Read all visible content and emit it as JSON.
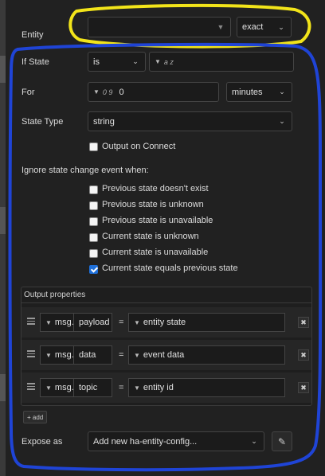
{
  "entity": {
    "label": "Entity",
    "value": "",
    "match": "exact"
  },
  "if_state": {
    "label": "If State",
    "operator": "is",
    "type_icon": "a z",
    "value": ""
  },
  "for": {
    "label": "For",
    "type_icon": "0 9",
    "value": "0",
    "unit": "minutes"
  },
  "state_type": {
    "label": "State Type",
    "value": "string"
  },
  "output_on_connect": {
    "label": "Output on Connect",
    "checked": false
  },
  "ignore": {
    "heading": "Ignore state change event when:",
    "options": [
      {
        "label": "Previous state doesn't exist",
        "checked": false
      },
      {
        "label": "Previous state is unknown",
        "checked": false
      },
      {
        "label": "Previous state is unavailable",
        "checked": false
      },
      {
        "label": "Current state is unknown",
        "checked": false
      },
      {
        "label": "Current state is unavailable",
        "checked": false
      },
      {
        "label": "Current state equals previous state",
        "checked": true
      }
    ]
  },
  "output_properties": {
    "heading": "Output properties",
    "rows": [
      {
        "prefix": "msg.",
        "property": "payload",
        "equals": "=",
        "value": "entity state"
      },
      {
        "prefix": "msg.",
        "property": "data",
        "equals": "=",
        "value": "event data"
      },
      {
        "prefix": "msg.",
        "property": "topic",
        "equals": "=",
        "value": "entity id"
      }
    ],
    "add_label": "+ add"
  },
  "expose_as": {
    "label": "Expose as",
    "value": "Add new ha-entity-config..."
  },
  "icons": {
    "chevron": "chevron-down-icon",
    "handle": "drag-handle-icon",
    "delete": "delete-icon",
    "edit": "pencil-icon"
  },
  "colors": {
    "annotation_yellow": "#f2e41a",
    "annotation_blue": "#1f44d6",
    "checkbox_accent": "#1e6fd9"
  }
}
